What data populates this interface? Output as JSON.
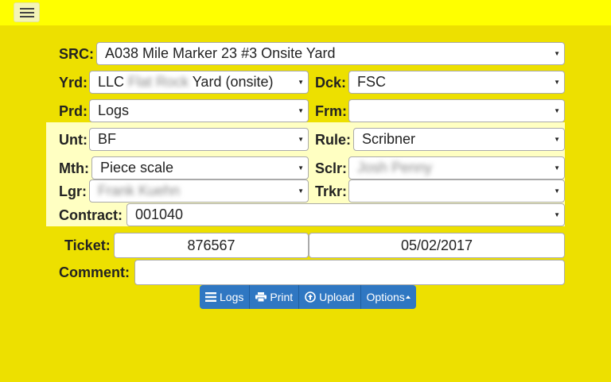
{
  "colors": {
    "page_bg": "#ede000",
    "topbar_bg": "#ffff00",
    "band_bg": "#ffffc2",
    "button_bg": "#2f77c2"
  },
  "form": {
    "src_label": "SRC:",
    "src_value": "A038 Mile Marker 23 #3 Onsite Yard",
    "yard_label": "Yrd:",
    "yard_prefix": "LLC",
    "yard_redacted": "Flat Rock",
    "yard_suffix": "Yard (onsite)",
    "deck_label": "Dck:",
    "deck_value": "FSC",
    "product_label": "Prd:",
    "product_value": "Logs",
    "from_label": "Frm:",
    "from_value": "",
    "unit_label": "Unt:",
    "unit_value": "BF",
    "rule_label": "Rule:",
    "rule_value": "Scribner",
    "method_label": "Mth:",
    "method_value": "Piece scale",
    "scaler_label": "Sclr:",
    "scaler_redacted": "Josh Penny",
    "logger_label": "Lgr:",
    "logger_redacted": "Frank Kuehn",
    "trucker_label": "Trkr:",
    "trucker_value": "",
    "contract_label": "Contract:",
    "contract_value": "001040",
    "ticket_label": "Ticket:",
    "ticket_value": "876567",
    "date_value": "05/02/2017",
    "comment_label": "Comment:",
    "comment_value": ""
  },
  "toolbar": {
    "logs": "Logs",
    "print": "Print",
    "upload": "Upload",
    "options": "Options"
  },
  "icons": {
    "menu": "hamburger-icon",
    "logs": "list-icon",
    "print": "print-icon",
    "upload": "upload-icon",
    "options": "caret-up-icon"
  }
}
